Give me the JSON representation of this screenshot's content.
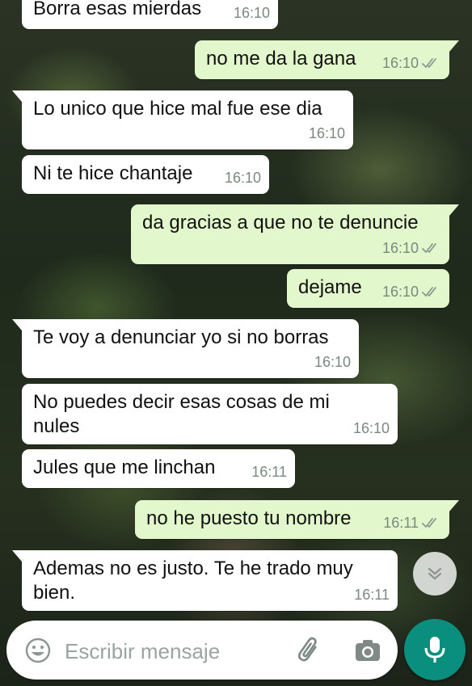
{
  "messages": [
    {
      "dir": "in",
      "text": "Borra esas mierdas",
      "time": "16:10"
    },
    {
      "dir": "out",
      "text": "no me da la gana",
      "time": "16:10",
      "read": true
    },
    {
      "dir": "in",
      "text": "Lo unico que hice mal fue ese dia",
      "time": "16:10"
    },
    {
      "dir": "in",
      "text": "Ni te hice chantaje",
      "time": "16:10"
    },
    {
      "dir": "out",
      "text": "da gracias a que no te denuncie",
      "time": "16:10",
      "read": true
    },
    {
      "dir": "out",
      "text": "dejame",
      "time": "16:10",
      "read": true
    },
    {
      "dir": "in",
      "text": "Te voy a denunciar yo si no borras",
      "time": "16:10"
    },
    {
      "dir": "in",
      "text": "No puedes decir esas cosas de mi\nnules",
      "time": "16:10"
    },
    {
      "dir": "in",
      "text": "Jules que me linchan",
      "time": "16:11"
    },
    {
      "dir": "out",
      "text": "no he puesto tu nombre",
      "time": "16:11",
      "read": true
    },
    {
      "dir": "in",
      "text": "Ademas no es justo. Te he trado muy\nbien.",
      "time": "16:11"
    }
  ],
  "composer": {
    "placeholder": "Escribir mensaje",
    "icons": {
      "emoji": "emoji-icon",
      "attach": "paperclip-icon",
      "camera": "camera-icon",
      "mic": "microphone-icon",
      "scroll": "chevron-double-down-icon"
    }
  },
  "colors": {
    "incoming": "#ffffff",
    "outgoing": "#e2f7cb",
    "accent": "#0a8f7f",
    "meta": "#7a8a7f",
    "ticks": "#8a9a8f"
  }
}
